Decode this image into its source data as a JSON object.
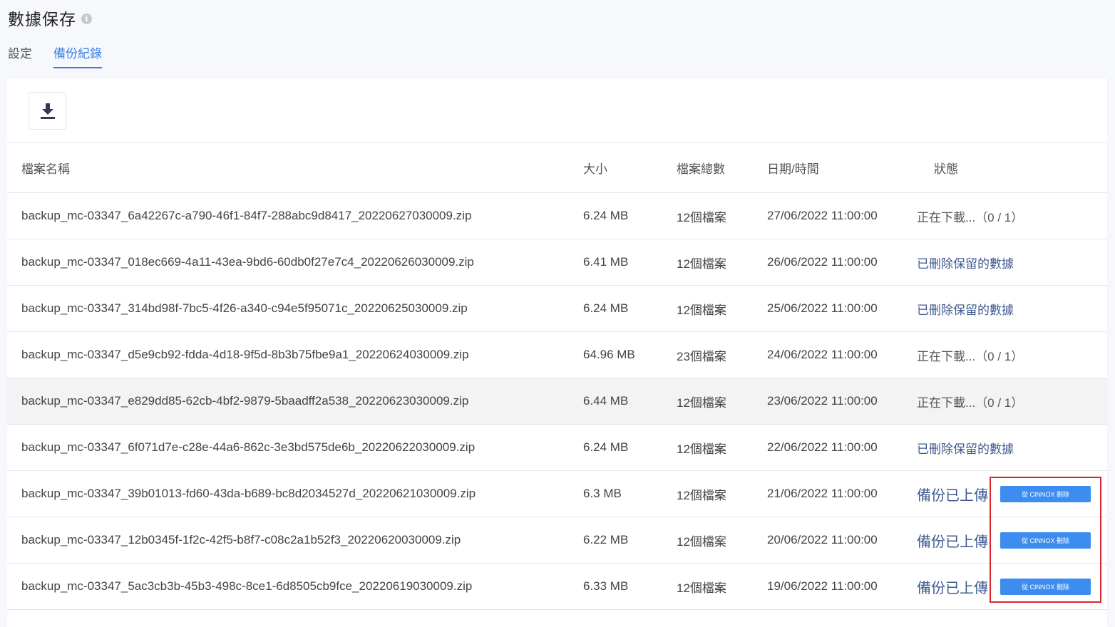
{
  "header": {
    "title": "數據保存",
    "info_icon": "info-icon"
  },
  "tabs": [
    {
      "label": "設定",
      "active": false
    },
    {
      "label": "備份紀錄",
      "active": true
    }
  ],
  "toolbar": {
    "download_icon": "download-icon"
  },
  "table": {
    "columns": [
      "檔案名稱",
      "大小",
      "檔案總數",
      "日期/時間",
      "狀態"
    ],
    "rows": [
      {
        "name": "backup_mc-03347_6a42267c-a790-46f1-84f7-288abc9d8417_20220627030009.zip",
        "size": "6.24 MB",
        "count": "12個檔案",
        "date": "27/06/2022 11:00:00",
        "status": "正在下載...（0 / 1）",
        "status_type": "downloading"
      },
      {
        "name": "backup_mc-03347_018ec669-4a11-43ea-9bd6-60db0f27e7c4_20220626030009.zip",
        "size": "6.41 MB",
        "count": "12個檔案",
        "date": "26/06/2022 11:00:00",
        "status": "已刪除保留的數據",
        "status_type": "deleted"
      },
      {
        "name": "backup_mc-03347_314bd98f-7bc5-4f26-a340-c94e5f95071c_20220625030009.zip",
        "size": "6.24 MB",
        "count": "12個檔案",
        "date": "25/06/2022 11:00:00",
        "status": "已刪除保留的數據",
        "status_type": "deleted"
      },
      {
        "name": "backup_mc-03347_d5e9cb92-fdda-4d18-9f5d-8b3b75fbe9a1_20220624030009.zip",
        "size": "64.96 MB",
        "count": "23個檔案",
        "date": "24/06/2022 11:00:00",
        "status": "正在下載...（0 / 1）",
        "status_type": "downloading"
      },
      {
        "name": "backup_mc-03347_e829dd85-62cb-4bf2-9879-5baadff2a538_20220623030009.zip",
        "size": "6.44 MB",
        "count": "12個檔案",
        "date": "23/06/2022 11:00:00",
        "status": "正在下載...（0 / 1）",
        "status_type": "downloading",
        "hover": true
      },
      {
        "name": "backup_mc-03347_6f071d7e-c28e-44a6-862c-3e3bd575de6b_20220622030009.zip",
        "size": "6.24 MB",
        "count": "12個檔案",
        "date": "22/06/2022 11:00:00",
        "status": "已刪除保留的數據",
        "status_type": "deleted"
      },
      {
        "name": "backup_mc-03347_39b01013-fd60-43da-b689-bc8d2034527d_20220621030009.zip",
        "size": "6.3 MB",
        "count": "12個檔案",
        "date": "21/06/2022 11:00:00",
        "status": "備份已上傳",
        "status_type": "uploaded",
        "action": "從 CINNOX 刪除"
      },
      {
        "name": "backup_mc-03347_12b0345f-1f2c-42f5-b8f7-c08c2a1b52f3_20220620030009.zip",
        "size": "6.22 MB",
        "count": "12個檔案",
        "date": "20/06/2022 11:00:00",
        "status": "備份已上傳",
        "status_type": "uploaded",
        "action": "從 CINNOX 刪除"
      },
      {
        "name": "backup_mc-03347_5ac3cb3b-45b3-498c-8ce1-6d8505cb9fce_20220619030009.zip",
        "size": "6.33 MB",
        "count": "12個檔案",
        "date": "19/06/2022 11:00:00",
        "status": "備份已上傳",
        "status_type": "uploaded",
        "action": "從 CINNOX 刪除"
      }
    ]
  },
  "colors": {
    "accent": "#3a7de0",
    "button": "#3d8cf0",
    "highlight": "#d9262b",
    "status_link": "#3f5a8f"
  }
}
